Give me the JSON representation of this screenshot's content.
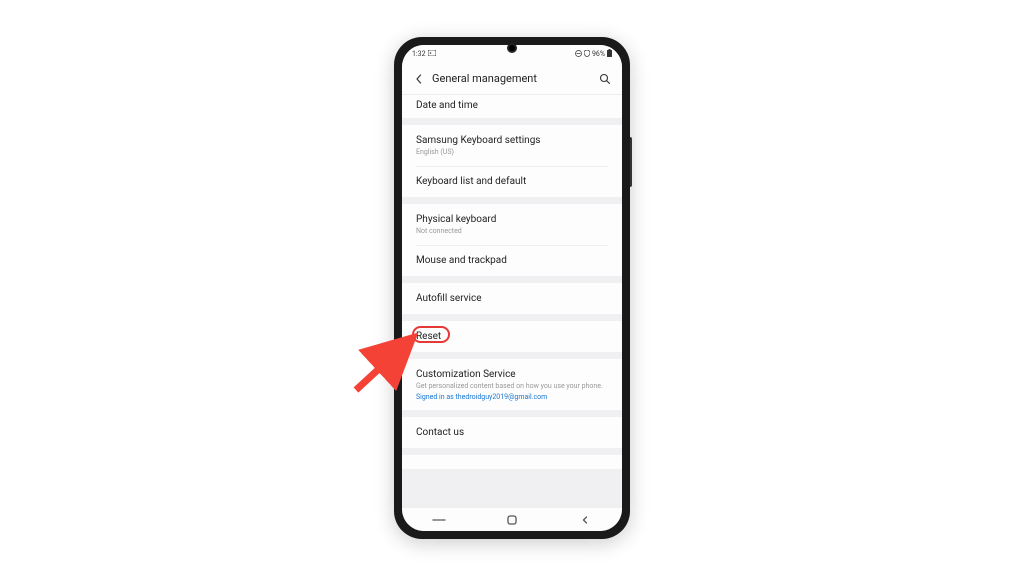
{
  "status_bar": {
    "time": "1:32",
    "battery_text": "96%"
  },
  "header": {
    "title": "General management"
  },
  "groups": [
    {
      "items": [
        {
          "title": "Date and time",
          "cut": true
        }
      ]
    },
    {
      "items": [
        {
          "title": "Samsung Keyboard settings",
          "subtitle": "English (US)"
        },
        {
          "title": "Keyboard list and default"
        }
      ]
    },
    {
      "items": [
        {
          "title": "Physical keyboard",
          "subtitle": "Not connected"
        },
        {
          "title": "Mouse and trackpad"
        }
      ]
    },
    {
      "items": [
        {
          "title": "Autofill service"
        }
      ]
    },
    {
      "items": [
        {
          "title": "Reset",
          "highlighted": true
        }
      ]
    },
    {
      "items": [
        {
          "title": "Customization Service",
          "subtitle": "Get personalized content based on how you use your phone.",
          "link": "Signed in as thedroidguy2019@gmail.com"
        }
      ]
    },
    {
      "items": [
        {
          "title": "Contact us"
        }
      ]
    }
  ],
  "annotation": {
    "highlight_color": "#e53935",
    "arrow_color": "#f44336"
  }
}
